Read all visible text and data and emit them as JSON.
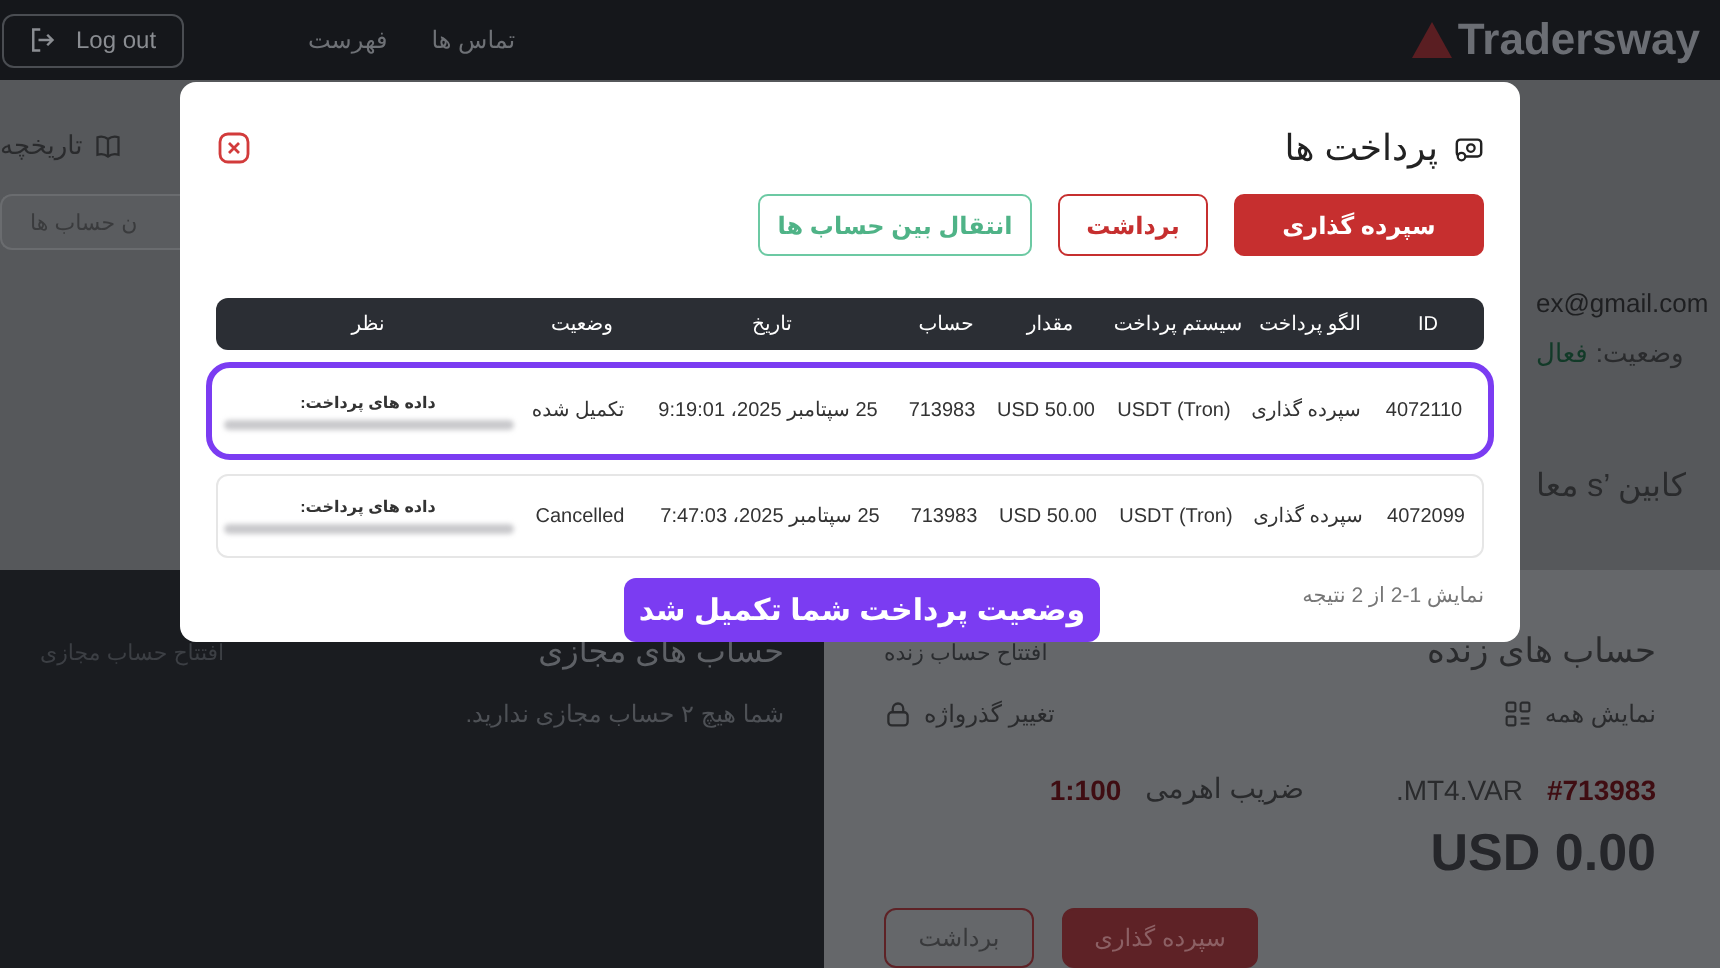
{
  "header": {
    "logout": "Log out",
    "nav": [
      "تماس ها",
      "فهرست"
    ],
    "logo": "Tradersway"
  },
  "side": {
    "history": "تاریخچه",
    "accounts_button": "ن حساب ها"
  },
  "profile": {
    "email": "ex@gmail.com",
    "status_label": "وضعیت:",
    "status_value": "فعال",
    "cabin": "کابین ’s معا"
  },
  "demo": {
    "title": "حساب های مجازی",
    "open": "افتتاح حساب مجازی",
    "empty": "شما هیچ ۲ حساب مجازی ندارید."
  },
  "live": {
    "title": "حساب های زنده",
    "open": "افتتاح حساب زنده",
    "show_all": "نمایش همه",
    "change_password": "تغییر گذرواژه",
    "account": "#713983",
    "type": ".MT4.VAR",
    "leverage_label": "ضریب اهرمی",
    "leverage": "1:100",
    "balance": "USD 0.00",
    "buttons": [
      {
        "label": "سپرده گذاری",
        "kind": "primary"
      },
      {
        "label": "برداشت",
        "kind": "outline"
      }
    ]
  },
  "modal": {
    "title": "پرداخت ها",
    "buttons": [
      {
        "label": "سپرده گذاری",
        "kind": "primary"
      },
      {
        "label": "برداشت",
        "kind": "outline"
      },
      {
        "label": "انتقال بین حساب ها",
        "kind": "success"
      }
    ],
    "table": {
      "columns": [
        "ID",
        "الگو پرداخت",
        "سیستم پرداخت",
        "مقدار",
        "حساب",
        "تاریخ",
        "وضعیت",
        "نظر"
      ],
      "rows": [
        {
          "cells": [
            "4072110",
            "سپرده گذاری",
            "USDT (Tron)",
            "USD 50.00",
            "713983",
            "25 سپتامبر 2025، 9:19:01",
            "تکمیل شده"
          ],
          "comment_label": "داده های پرداخت:",
          "highlighted": true
        },
        {
          "cells": [
            "4072099",
            "سپرده گذاری",
            "USDT (Tron)",
            "USD 50.00",
            "713983",
            "25 سپتامبر 2025، 7:47:03",
            "Cancelled"
          ],
          "comment_label": "داده های پرداخت:",
          "highlighted": false
        }
      ]
    },
    "footer": "نمایش 1-2 از 2 نتیجه"
  },
  "callout": "وضعیت پرداخت شما تکمیل شد"
}
